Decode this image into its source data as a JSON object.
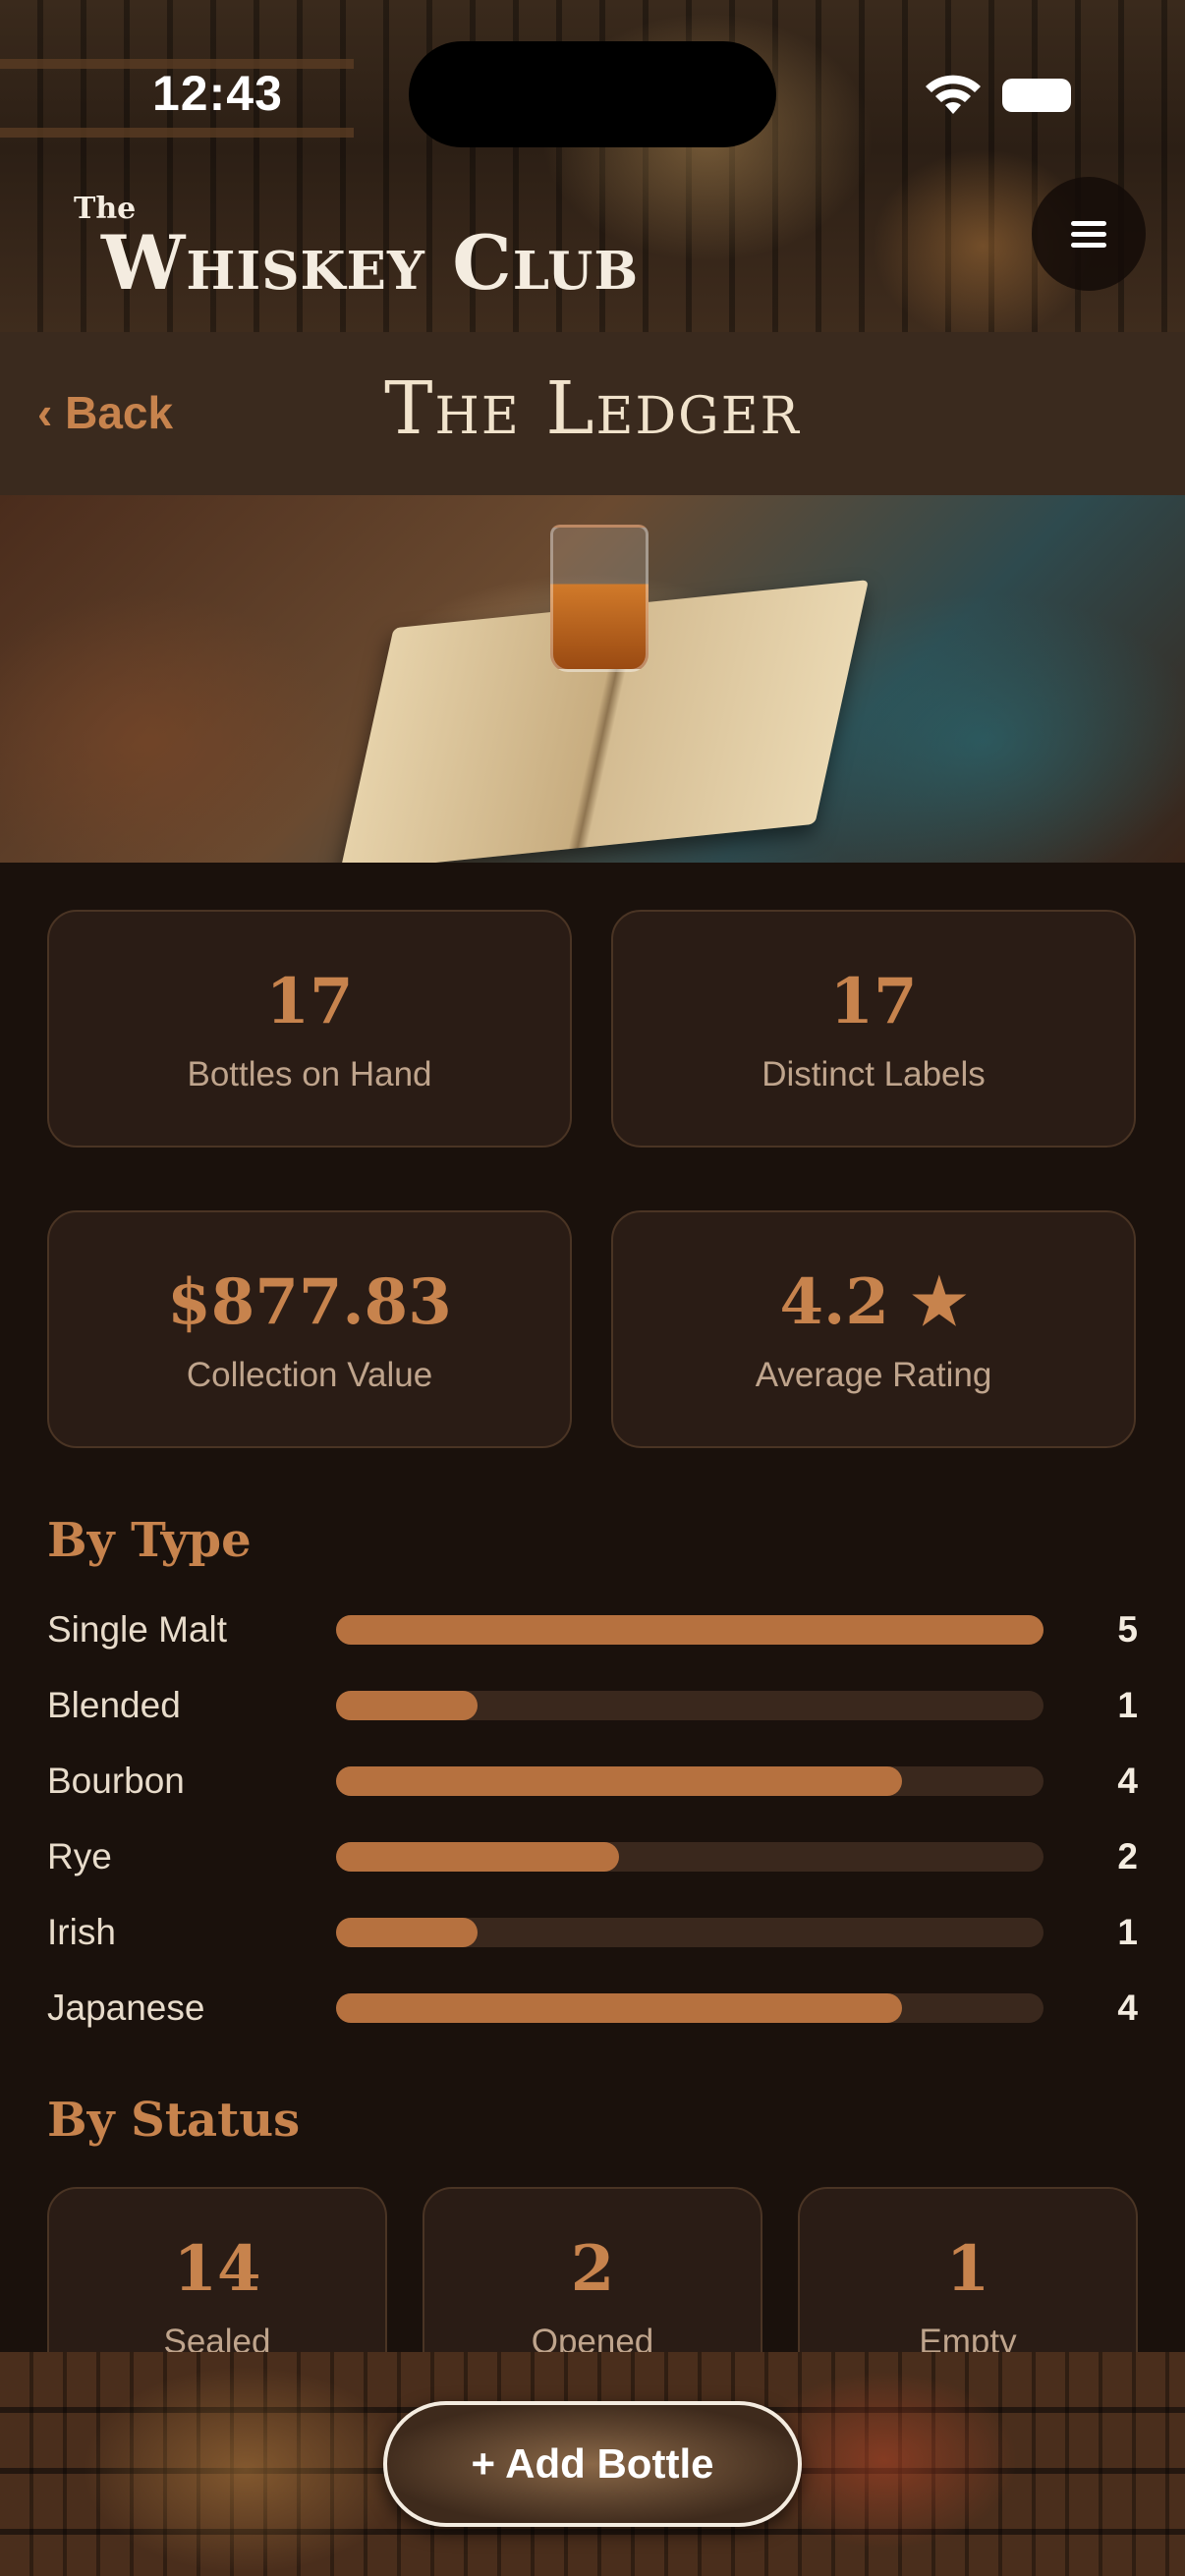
{
  "status_bar": {
    "time": "12:43"
  },
  "header": {
    "logo_the": "The",
    "logo_main": "Whiskey Club"
  },
  "title_bar": {
    "back_label": "‹ Back",
    "title": "The Ledger"
  },
  "stats": [
    {
      "value": "17",
      "label": "Bottles on Hand"
    },
    {
      "value": "17",
      "label": "Distinct Labels"
    },
    {
      "value": "$877.83",
      "label": "Collection Value"
    },
    {
      "value": "4.2 ★",
      "label": "Average Rating"
    }
  ],
  "by_type": {
    "heading": "By Type",
    "max": 5,
    "rows": [
      {
        "label": "Single Malt",
        "count": 5
      },
      {
        "label": "Blended",
        "count": 1
      },
      {
        "label": "Bourbon",
        "count": 4
      },
      {
        "label": "Rye",
        "count": 2
      },
      {
        "label": "Irish",
        "count": 1
      },
      {
        "label": "Japanese",
        "count": 4
      }
    ]
  },
  "by_status": {
    "heading": "By Status",
    "items": [
      {
        "value": "14",
        "label": "Sealed"
      },
      {
        "value": "2",
        "label": "Opened"
      },
      {
        "value": "1",
        "label": "Empty"
      }
    ]
  },
  "footer": {
    "add_label": "+ Add Bottle"
  },
  "colors": {
    "accent": "#c7834d",
    "bar_fill": "#b6713f",
    "card_bg": "#2a1c15",
    "page_bg": "#1a110c"
  }
}
